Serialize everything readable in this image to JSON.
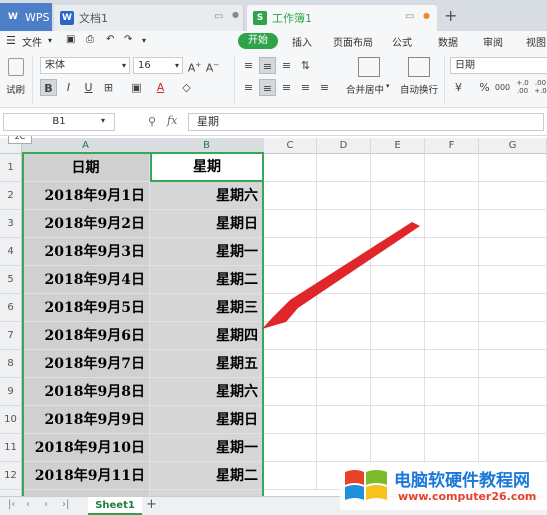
{
  "titlebar": {
    "tabs": [
      {
        "label": "WPS",
        "icon": "wps-logo-icon"
      },
      {
        "label": "文档1",
        "icon": "word-doc-icon"
      },
      {
        "label": "工作簿1",
        "icon": "spreadsheet-icon",
        "active": true
      }
    ],
    "new_tab": "+"
  },
  "menubar": {
    "file": "文件",
    "items": [
      "开始",
      "插入",
      "页面布局",
      "公式",
      "数据",
      "审阅",
      "视图"
    ],
    "active": "开始"
  },
  "ribbon": {
    "font_name": "宋体",
    "font_size": "16",
    "paste_label": "试刷",
    "bold": "B",
    "italic": "I",
    "underline": "U",
    "merge_label": "合并居中",
    "wrap_label": "自动换行",
    "number_format": "日期",
    "percent": "%",
    "comma": "000",
    "inc_decimal": "+.0\n.00",
    "dec_decimal": ".00\n+.0"
  },
  "formula_bar": {
    "name_box": "B1",
    "fx": "fx",
    "value": "星期",
    "tooltip": "2C"
  },
  "grid": {
    "columns": [
      "A",
      "B",
      "C",
      "D",
      "E",
      "F",
      "G"
    ],
    "rows": [
      {
        "n": "1",
        "a": "日期",
        "b": "星期"
      },
      {
        "n": "2",
        "a": "2018年9月1日",
        "b": "星期六"
      },
      {
        "n": "3",
        "a": "2018年9月2日",
        "b": "星期日"
      },
      {
        "n": "4",
        "a": "2018年9月3日",
        "b": "星期一"
      },
      {
        "n": "5",
        "a": "2018年9月4日",
        "b": "星期二"
      },
      {
        "n": "6",
        "a": "2018年9月5日",
        "b": "星期三"
      },
      {
        "n": "7",
        "a": "2018年9月6日",
        "b": "星期四"
      },
      {
        "n": "8",
        "a": "2018年9月7日",
        "b": "星期五"
      },
      {
        "n": "9",
        "a": "2018年9月8日",
        "b": "星期六"
      },
      {
        "n": "10",
        "a": "2018年9月9日",
        "b": "星期日"
      },
      {
        "n": "11",
        "a": "2018年9月10日",
        "b": "星期一"
      },
      {
        "n": "12",
        "a": "2018年9月11日",
        "b": "星期二"
      }
    ]
  },
  "sheetbar": {
    "sheet_name": "Sheet1",
    "add_sheet": "+"
  },
  "watermark": {
    "title": "电脑软硬件教程网",
    "url": "www.computer26.com"
  },
  "colors": {
    "accent": "#2fa34b",
    "arrow": "#e0262b"
  }
}
